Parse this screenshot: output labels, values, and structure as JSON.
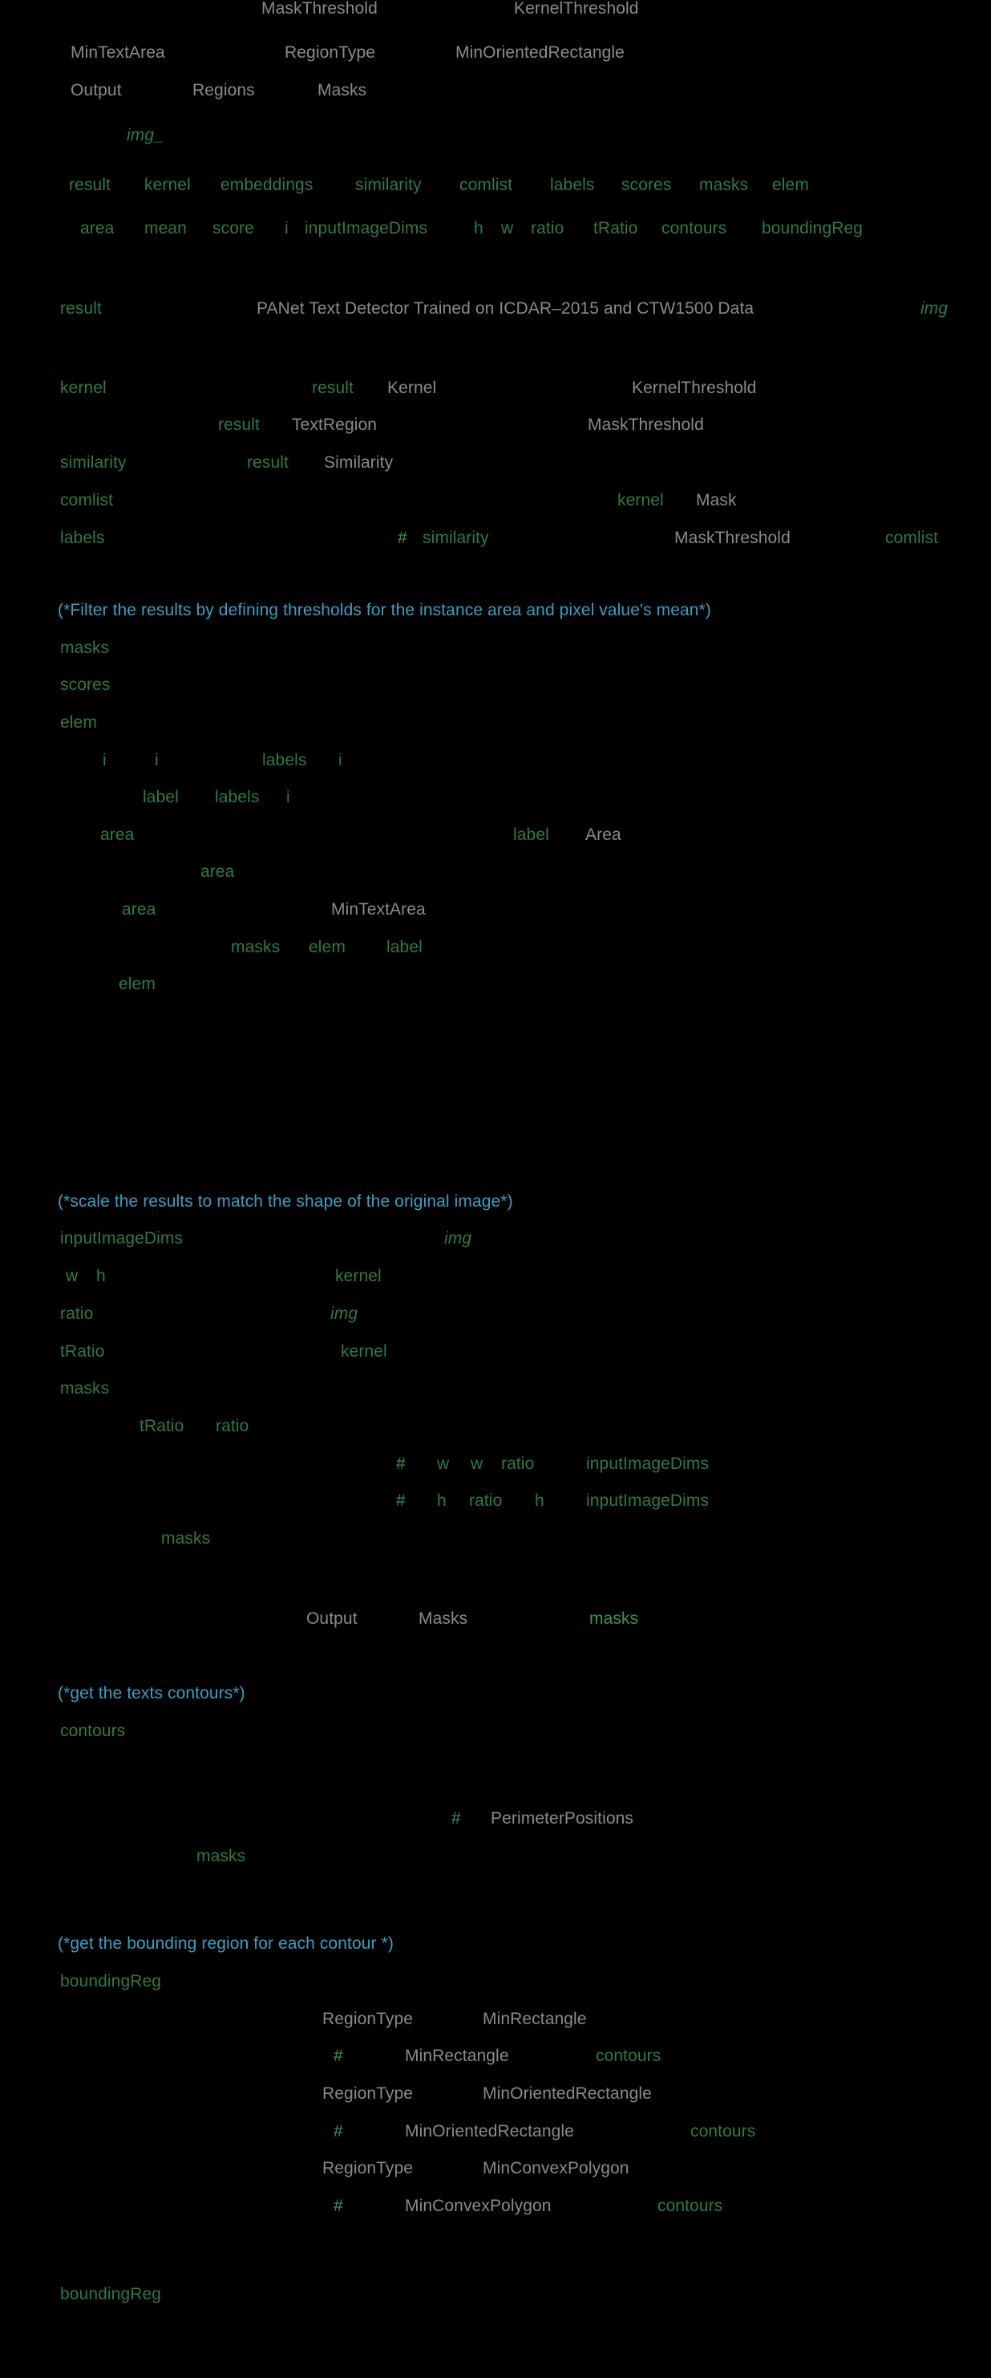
{
  "document": {
    "kind": "wolfram-language-code-cell",
    "background": "#000000",
    "colors": {
      "symbol_gray": "#8a8a8a",
      "variable_green": "#2f7a44",
      "variable_green_bright": "#3f9157",
      "comment_cyan": "#3a9fc4",
      "background": "#000000"
    }
  },
  "tokens": {
    "header": {
      "mask_threshold": "MaskThreshold",
      "kernel_threshold": "KernelThreshold",
      "min_text_area": "MinTextArea",
      "region_type": "RegionType",
      "min_oriented_rectangle": "MinOrientedRectangle",
      "output": "Output",
      "regions": "Regions",
      "masks": "Masks",
      "img_pattern": "img_"
    },
    "locals_line1": [
      "result",
      "kernel",
      "embeddings",
      "similarity",
      "comlist",
      "labels",
      "scores",
      "masks",
      "elem"
    ],
    "locals_line2": [
      "area",
      "mean",
      "score",
      "i",
      "inputImageDims",
      "h",
      "w",
      "ratio",
      "tRatio",
      "contours",
      "boundingReg"
    ],
    "result_line": {
      "assign_target": "result",
      "net_name": "PANet Text Detector Trained on ICDAR–2015 and CTW1500 Data",
      "arg": "img"
    },
    "kernel_block": {
      "kernel": "kernel",
      "result_1": "result",
      "kernel_key": "Kernel",
      "kernel_threshold": "KernelThreshold",
      "result_2": "result",
      "text_region": "TextRegion",
      "mask_threshold": "MaskThreshold",
      "similarity": "similarity",
      "result_3": "result",
      "similarity_key": "Similarity",
      "comlist": "comlist",
      "kernel_ref": "kernel",
      "mask_key": "Mask",
      "labels": "labels",
      "slot": "#",
      "similarity_ref": "similarity",
      "mask_threshold_2": "MaskThreshold",
      "comlist_ref": "comlist"
    },
    "filter_section": {
      "comment": "(*Filter the results by defining thresholds for the instance area and pixel value's mean*)",
      "masks": "masks",
      "scores": "scores",
      "elem": "elem",
      "i_1": "i",
      "i_2": "i",
      "labels_ref": "labels",
      "i_3": "i",
      "label": "label",
      "labels_ref2": "labels",
      "i_4": "i",
      "area_1": "area",
      "label_ref": "label",
      "area_key": "Area",
      "area_2": "area",
      "area_3": "area",
      "min_text_area": "MinTextArea",
      "masks_ref": "masks",
      "elem_ref": "elem",
      "label_ref2": "label",
      "elem_2": "elem"
    },
    "scale_section": {
      "comment": "(*scale the results to match the shape of the original image*)",
      "input_image_dims": "inputImageDims",
      "img": "img",
      "w": "w",
      "h": "h",
      "kernel": "kernel",
      "ratio": "ratio",
      "img_2": "img",
      "t_ratio": "tRatio",
      "kernel_2": "kernel",
      "masks": "masks",
      "t_ratio_2": "tRatio",
      "ratio_2": "ratio",
      "slot_w": "#",
      "w_2": "w",
      "w_3": "w",
      "ratio_3": "ratio",
      "input_image_dims_2": "inputImageDims",
      "slot_h": "#",
      "h_2": "h",
      "ratio_4": "ratio",
      "h_3": "h",
      "input_image_dims_3": "inputImageDims",
      "masks_2": "masks",
      "output": "Output",
      "masks_key": "Masks",
      "masks_val": "masks"
    },
    "contours_section": {
      "comment": "(*get the texts contours*)",
      "contours": "contours",
      "slot": "#",
      "perimeter_positions": "PerimeterPositions",
      "masks": "masks"
    },
    "bounding_section": {
      "comment": "(*get the bounding region for each contour *)",
      "bounding_reg": "boundingReg",
      "region_type_1": "RegionType",
      "min_rectangle": "MinRectangle",
      "slot_1": "#",
      "min_rectangle_2": "MinRectangle",
      "contours_1": "contours",
      "region_type_2": "RegionType",
      "min_oriented_rectangle": "MinOrientedRectangle",
      "slot_2": "#",
      "min_oriented_rectangle_2": "MinOrientedRectangle",
      "contours_2": "contours",
      "region_type_3": "RegionType",
      "min_convex_polygon": "MinConvexPolygon",
      "slot_3": "#",
      "min_convex_polygon_2": "MinConvexPolygon",
      "contours_3": "contours",
      "bounding_reg_2": "boundingReg"
    }
  }
}
